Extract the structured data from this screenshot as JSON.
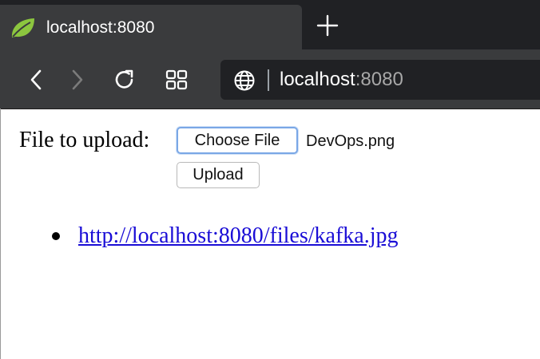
{
  "browser": {
    "tab_title": "localhost:8080",
    "url_host": "localhost",
    "url_port": ":8080",
    "icons": [
      "spring-leaf-icon",
      "new-tab-plus-icon",
      "back-icon",
      "forward-icon",
      "reload-icon",
      "tab-grid-icon",
      "globe-icon"
    ]
  },
  "page": {
    "upload_label": "File to upload:",
    "choose_file_label": "Choose File",
    "selected_file": "DevOps.png",
    "upload_button": "Upload",
    "files": [
      {
        "link_text": "http://localhost:8080/files/kafka.jpg"
      }
    ]
  },
  "colors": {
    "link": "#1a0dd6",
    "chrome_dark": "#202124",
    "chrome_mid": "#3a3b3d",
    "favicon": "#8cc63f",
    "focus_ring": "#7aa7e6"
  }
}
